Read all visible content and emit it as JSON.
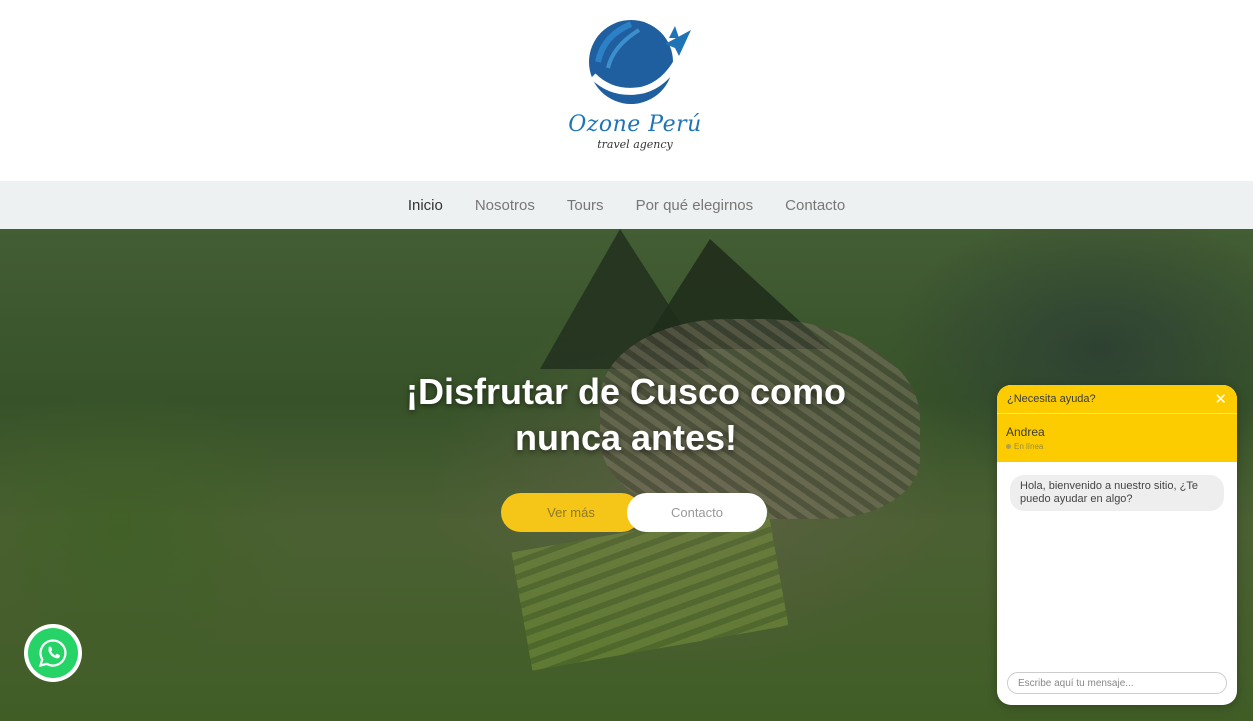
{
  "brand": {
    "name": "Ozone Perú",
    "tagline": "travel agency",
    "colors": {
      "primary": "#1f74b5",
      "accent": "#f5c518"
    }
  },
  "nav": {
    "items": [
      {
        "label": "Inicio",
        "active": true
      },
      {
        "label": "Nosotros",
        "active": false
      },
      {
        "label": "Tours",
        "active": false
      },
      {
        "label": "Por qué elegirnos",
        "active": false
      },
      {
        "label": "Contacto",
        "active": false
      }
    ]
  },
  "hero": {
    "title_line1": "¡Disfrutar de Cusco como",
    "title_line2": "nunca antes!",
    "primary_button": "Ver más",
    "secondary_button": "Contacto"
  },
  "whatsapp": {
    "icon": "whatsapp-icon",
    "color": "#25d366"
  },
  "chat": {
    "header_question": "¿Necesita ayuda?",
    "agent_name": "Andrea",
    "agent_status": "En línea",
    "greeting": "Hola, bienvenido a nuestro sitio, ¿Te puedo ayudar en algo?",
    "input_placeholder": "Escribe aquí tu mensaje...",
    "header_color": "#fccc00"
  }
}
